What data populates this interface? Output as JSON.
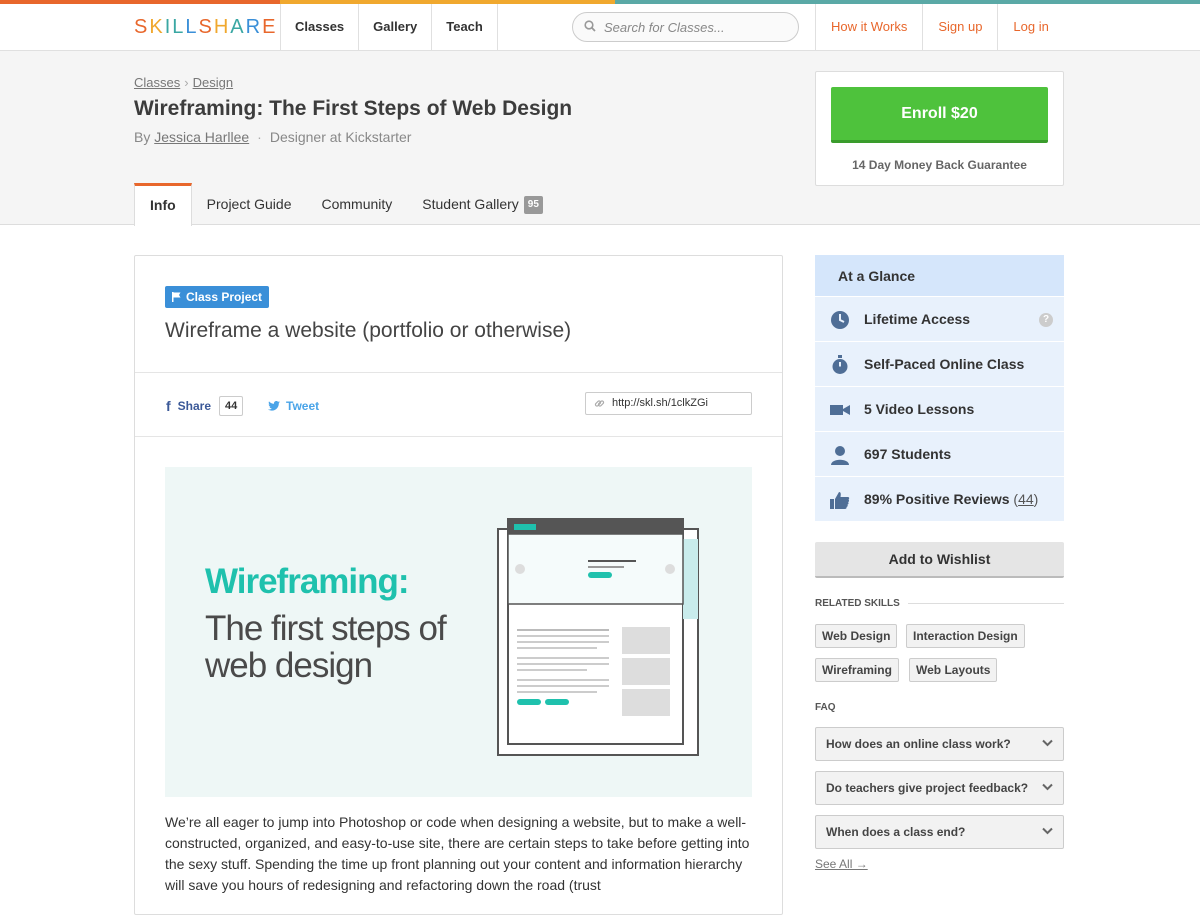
{
  "brand": {
    "logo_letters": [
      "S",
      "K",
      "I",
      "L",
      "L",
      "S",
      "H",
      "A",
      "R",
      "E"
    ],
    "logo_colors": [
      "#e8672c",
      "#f0a82e",
      "#3aa7a3",
      "#3aa7a3",
      "#3a8fd8",
      "#e8672c",
      "#f0a82e",
      "#3aa7a3",
      "#3a8fd8",
      "#e8672c"
    ],
    "accent": "#e8672c",
    "enroll_green": "#4ec23c"
  },
  "nav": {
    "links": [
      "Classes",
      "Gallery",
      "Teach"
    ],
    "search_placeholder": "Search for Classes...",
    "right_links": [
      "How it Works",
      "Sign up",
      "Log in"
    ]
  },
  "header": {
    "breadcrumb": [
      "Classes",
      "Design"
    ],
    "title": "Wireframing: The First Steps of Web Design",
    "by": "By",
    "author": "Jessica Harllee",
    "author_role": "Designer at Kickstarter",
    "tabs": [
      "Info",
      "Project Guide",
      "Community",
      "Student Gallery"
    ],
    "gallery_count": "95"
  },
  "enroll": {
    "button": "Enroll $20",
    "guarantee": "14 Day Money Back Guarantee"
  },
  "project": {
    "badge": "Class Project",
    "title": "Wireframe a website (portfolio or otherwise)",
    "share_label": "Share",
    "share_count": "44",
    "tweet_label": "Tweet",
    "short_url": "http://skl.sh/1clkZGi",
    "banner_title": "Wireframing:",
    "banner_subtitle": "The first steps of web design",
    "body": "We’re all eager to jump into Photoshop or code when designing a website, but to make a well-constructed, organized, and easy-to-use site, there are certain steps to take before getting into the sexy stuff. Spending the time up front planning out your content and information hierarchy will save you hours of redesigning and refactoring down the road (trust"
  },
  "glance": {
    "heading": "At a Glance",
    "items": [
      {
        "icon": "clock-icon",
        "label": "Lifetime Access"
      },
      {
        "icon": "stopwatch-icon",
        "label": "Self-Paced Online Class"
      },
      {
        "icon": "video-camera-icon",
        "label": "5 Video Lessons"
      },
      {
        "icon": "person-icon",
        "label": "697 Students"
      },
      {
        "icon": "thumbs-up-icon",
        "label": "89% Positive Reviews"
      }
    ],
    "review_count": "44",
    "wishlist": "Add to Wishlist"
  },
  "skills": {
    "heading": "RELATED SKILLS",
    "items": [
      "Web Design",
      "Interaction Design",
      "Wireframing",
      "Web Layouts"
    ]
  },
  "faq": {
    "heading": "FAQ",
    "items": [
      "How does an online class work?",
      "Do teachers give project feedback?",
      "When does a class end?"
    ],
    "see_all": "See All →"
  }
}
